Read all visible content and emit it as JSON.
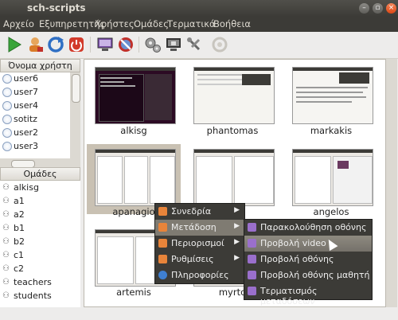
{
  "window": {
    "title": "sch-scripts"
  },
  "menubar": [
    "Αρχείο",
    "Εξυπηρετητής",
    "Χρήστες",
    "Ομάδες",
    "Τερματικά",
    "Βοήθεια"
  ],
  "toolbar": [
    {
      "icon": "play-icon",
      "color": "#3aa53a"
    },
    {
      "icon": "user-add-icon",
      "color": "#d97b28"
    },
    {
      "icon": "refresh-icon",
      "color": "#2f6fc4"
    },
    {
      "icon": "power-icon",
      "color": "#d23a2a"
    },
    {
      "icon": "monitor-icon",
      "color": "#7a4fa8"
    },
    {
      "icon": "no-entry-icon",
      "color": "#c0302a"
    },
    {
      "icon": "gears-icon",
      "color": "#777777"
    },
    {
      "icon": "screen-lock-icon",
      "color": "#555555"
    },
    {
      "icon": "tools-icon",
      "color": "#777777"
    },
    {
      "icon": "help-icon",
      "color": "#bbbbbb"
    }
  ],
  "users": {
    "header": "Όνομα χρήστη",
    "items": [
      "user6",
      "user7",
      "user4",
      "sotitz",
      "user2",
      "user3"
    ]
  },
  "groups": {
    "header": "Ομάδες",
    "items": [
      "alkisg",
      "a1",
      "a2",
      "b1",
      "b2",
      "c1",
      "c2",
      "teachers",
      "students"
    ]
  },
  "clients": [
    {
      "name": "alkisg",
      "screen": "terminal"
    },
    {
      "name": "phantomas",
      "screen": "desktop"
    },
    {
      "name": "markakis",
      "screen": "document"
    },
    {
      "name": "apanagio",
      "screen": "filemanager",
      "selected": true
    },
    {
      "name": "",
      "screen": "filemanager"
    },
    {
      "name": "angelos",
      "screen": "filemanager"
    },
    {
      "name": "artemis",
      "screen": "filemanager"
    },
    {
      "name": "myrto",
      "screen": "filemanager"
    }
  ],
  "context_menu": [
    {
      "label": "Συνεδρία",
      "icon": "folder-icon",
      "submenu": true
    },
    {
      "label": "Μετάδοση",
      "icon": "folder-icon",
      "submenu": true,
      "highlighted": true
    },
    {
      "label": "Περιορισμοί",
      "icon": "folder-icon",
      "submenu": true
    },
    {
      "label": "Ρυθμίσεις",
      "icon": "folder-icon",
      "submenu": true
    },
    {
      "label": "Πληροφορίες",
      "icon": "info-icon",
      "submenu": false
    }
  ],
  "submenu": [
    {
      "label": "Παρακολούθηση οθόνης",
      "icon": "screen-icon"
    },
    {
      "label": "Προβολή video",
      "icon": "video-icon",
      "highlighted": true
    },
    {
      "label": "Προβολή οθόνης",
      "icon": "screen-icon"
    },
    {
      "label": "Προβολή οθόνης μαθητή",
      "icon": "screen-icon"
    },
    {
      "label": "Τερματισμός μεταδόσεων",
      "icon": "stop-icon"
    }
  ],
  "colors": {
    "accent": "#f07746",
    "menu_bg": "#3c3b37",
    "highlight": "#7f7b72"
  }
}
